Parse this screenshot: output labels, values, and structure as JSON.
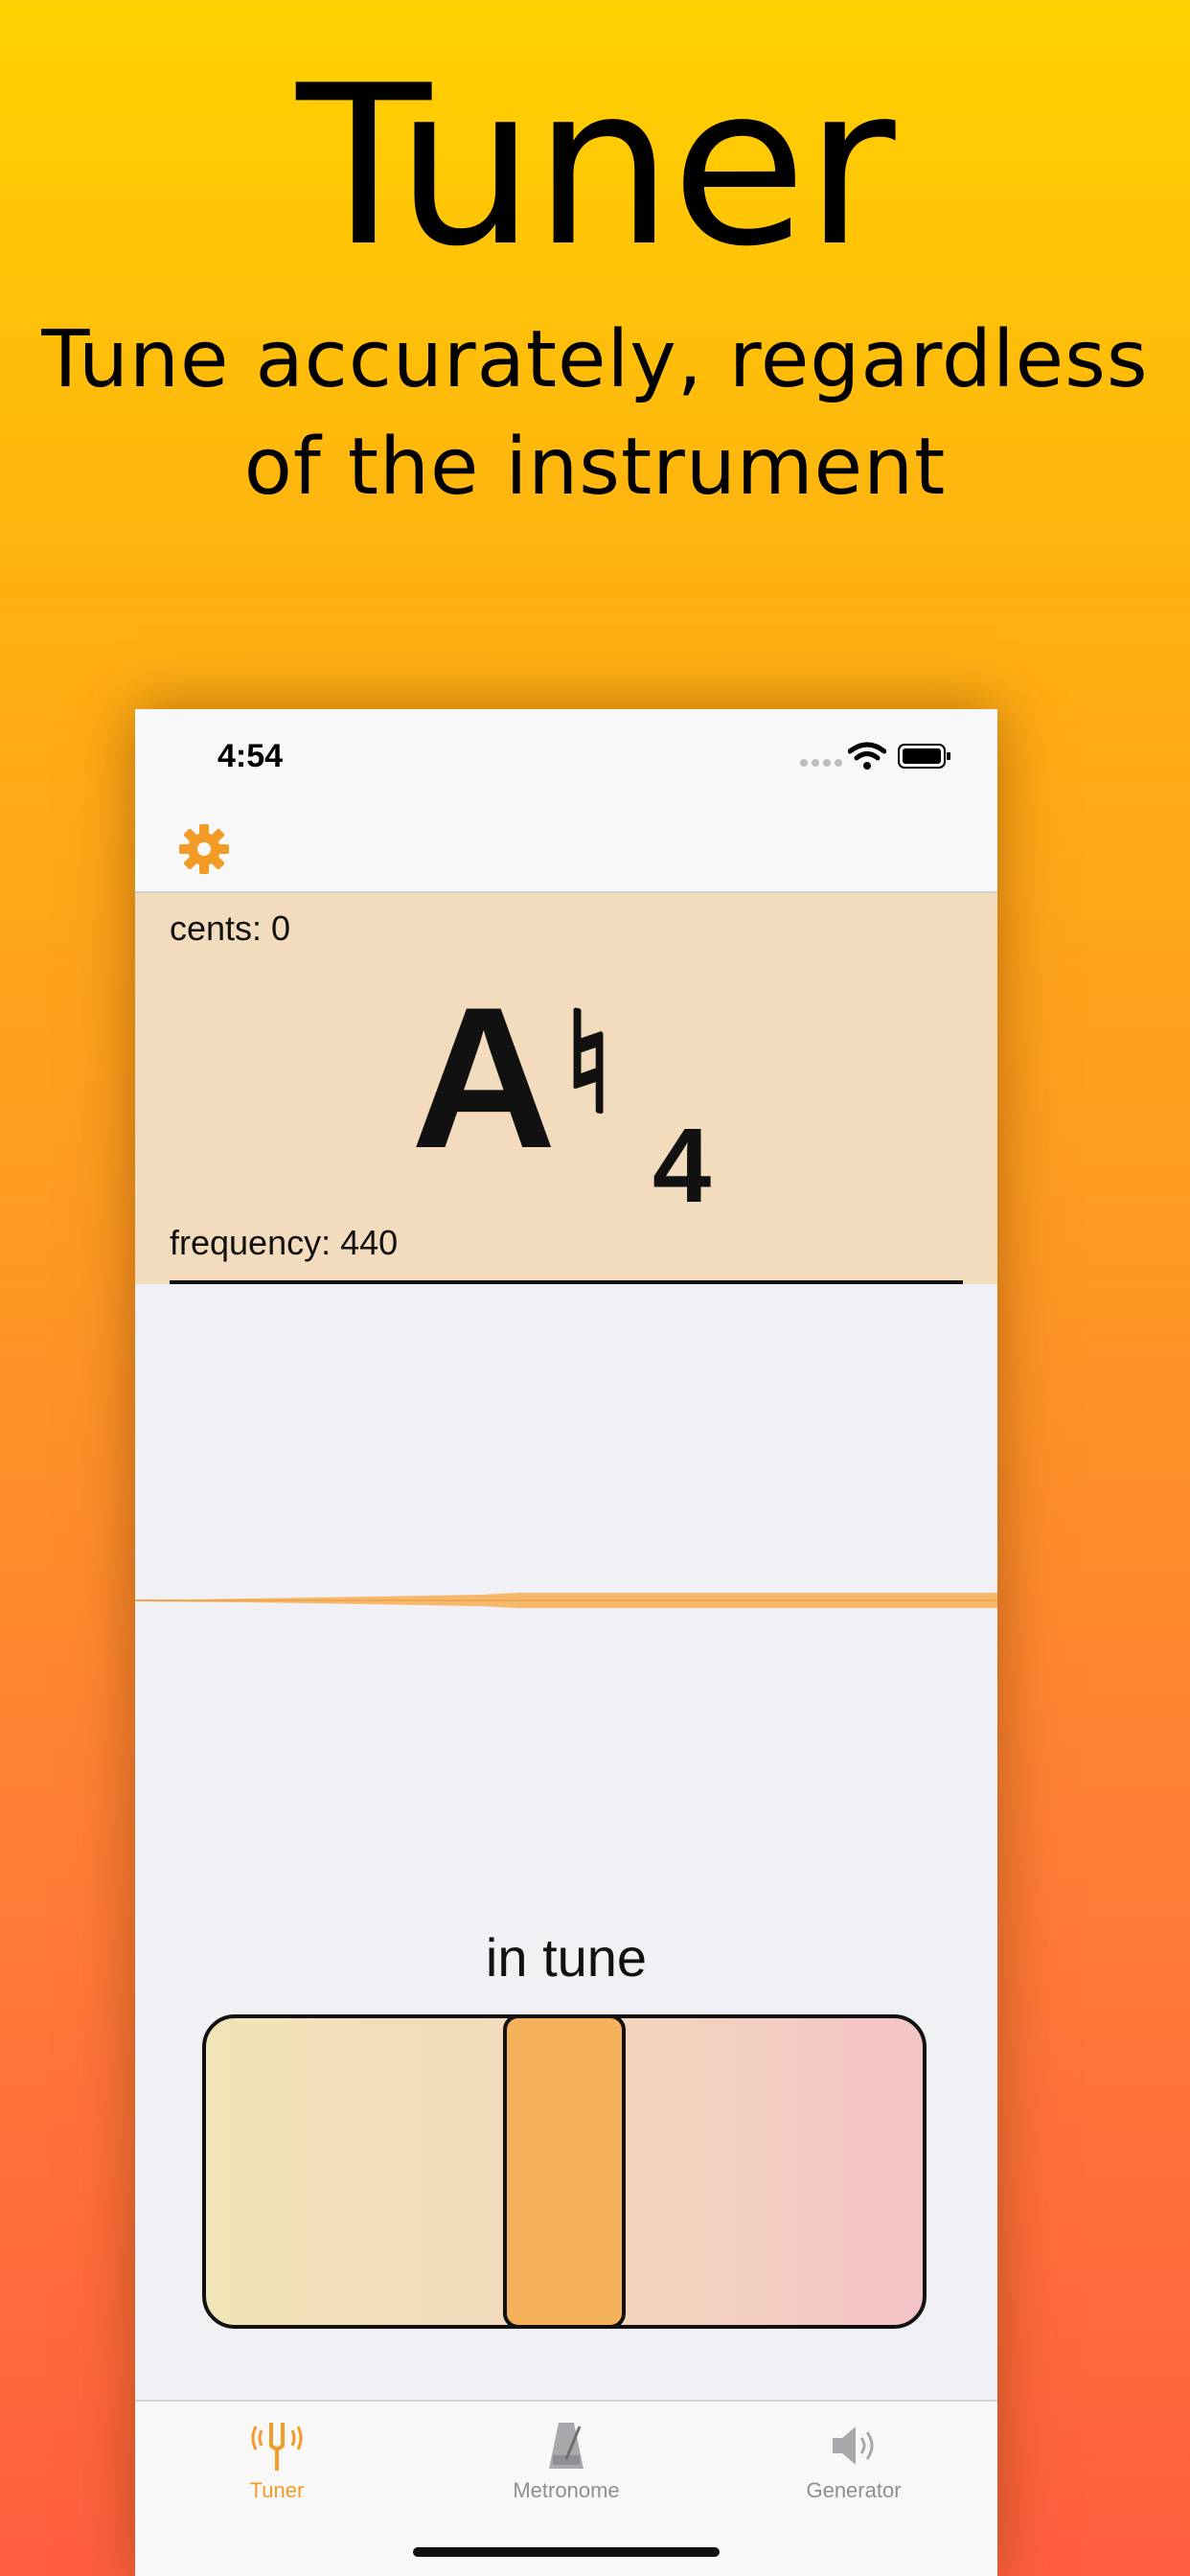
{
  "hero": {
    "title": "Tuner",
    "subtitle_line1": "Tune accurately, regardless",
    "subtitle_line2": "of the instrument"
  },
  "status_bar": {
    "time": "4:54"
  },
  "tuner": {
    "cents_label": "cents: 0",
    "note": "A",
    "accidental": "♮",
    "octave": "4",
    "frequency_label": "frequency: 440",
    "status": "in tune"
  },
  "tabs": [
    {
      "label": "Tuner",
      "icon": "tuning-fork-icon",
      "active": true
    },
    {
      "label": "Metronome",
      "icon": "metronome-icon",
      "active": false
    },
    {
      "label": "Generator",
      "icon": "speaker-icon",
      "active": false
    }
  ],
  "colors": {
    "accent": "#f29b27",
    "panel": "#f3dbbd",
    "indicator": "#f6b15b"
  }
}
